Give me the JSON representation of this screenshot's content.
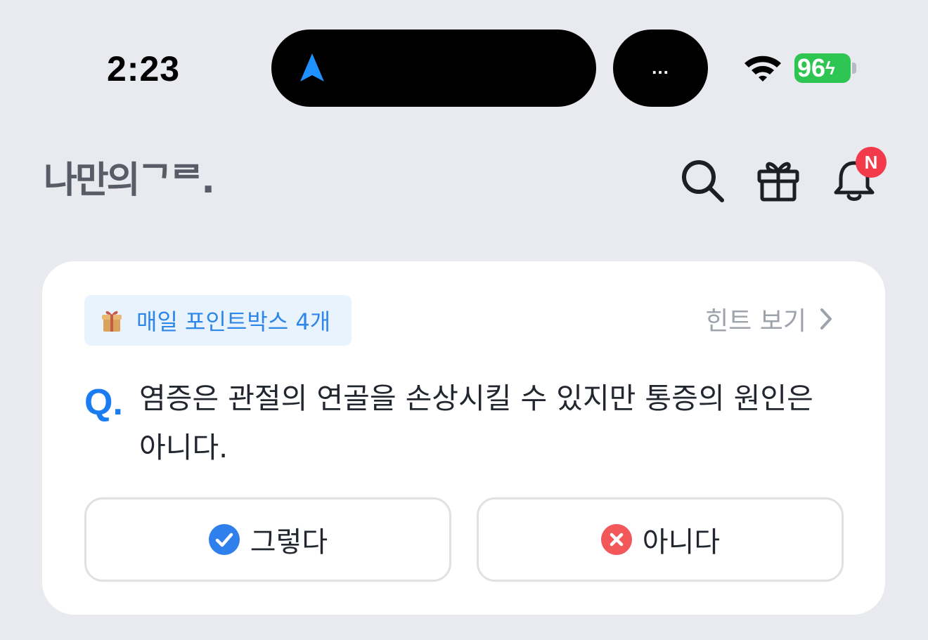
{
  "status_bar": {
    "time": "2:23",
    "island_dots": "...",
    "battery_level": "96",
    "battery_charging": "ϟ",
    "battery_color": "#2fc553"
  },
  "header": {
    "logo": "나만의ᄀᄅ.",
    "icons": [
      "search-icon",
      "gift-icon",
      "bell-icon"
    ],
    "notification_badge": "N",
    "badge_color": "#f23a4a"
  },
  "quiz": {
    "reward_pill": "매일 포인트박스 4개",
    "hint_label": "힌트 보기",
    "q_mark": "Q.",
    "question": "염증은 관절의 연골을 손상시킬 수 있지만 통증의 원인은 아니다.",
    "yes_label": "그렇다",
    "no_label": "아니다",
    "yes_color": "#2f80ed",
    "no_color": "#f2575a",
    "accent_color": "#1a7cf0"
  }
}
